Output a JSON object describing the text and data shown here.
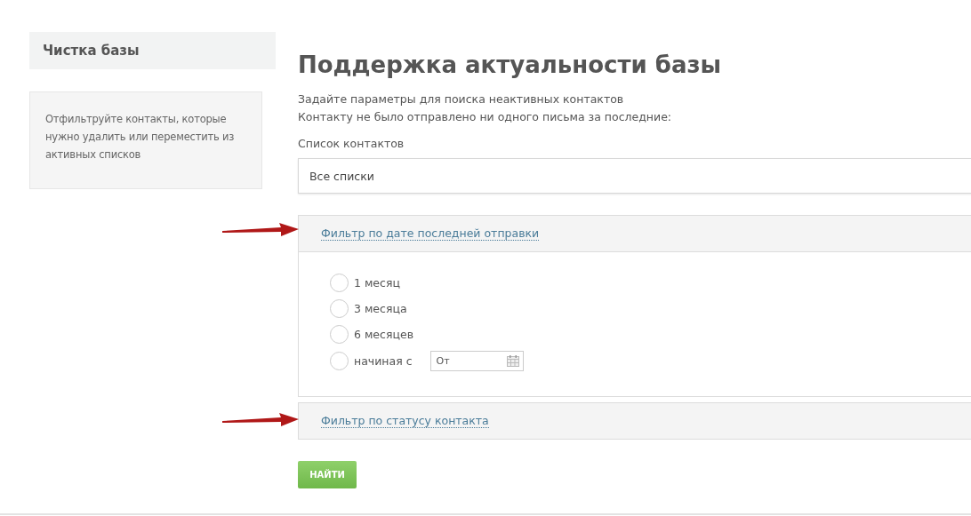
{
  "sidebar": {
    "title": "Чистка базы",
    "note": "Отфильтруйте контакты, которые нужно удалить или переместить из активных списков"
  },
  "main": {
    "title": "Поддержка актуальности базы",
    "intro": [
      "Задайте параметры для поиска неактивных контактов",
      "Контакту не было отправлено ни одного письма за последние:"
    ],
    "list_label": "Список контактов",
    "list_value": "Все списки",
    "filters": [
      {
        "title": "Фильтр по дате последней отправки",
        "expanded": true,
        "options": [
          {
            "kind": "radio",
            "label": "1 месяц",
            "selected": false
          },
          {
            "kind": "radio",
            "label": "3 месяца",
            "selected": false
          },
          {
            "kind": "radio",
            "label": "6 месяцев",
            "selected": false
          },
          {
            "kind": "date",
            "label": "начиная с",
            "selected": false,
            "placeholder": "От"
          }
        ]
      },
      {
        "title": "Фильтр по статусу контакта",
        "expanded": false
      }
    ],
    "button": "НАЙТИ"
  }
}
